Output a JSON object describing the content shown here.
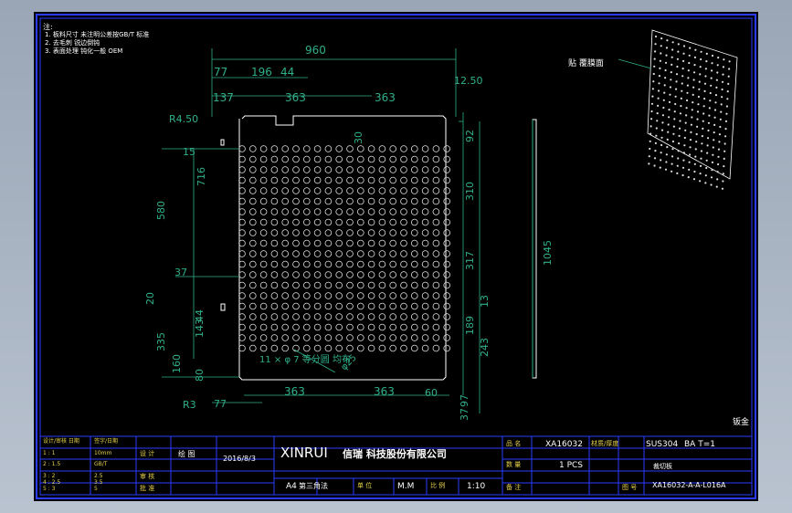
{
  "notes": {
    "heading": "注:",
    "lines": [
      "1. 板料尺寸 未注明公差按GB/T 标准",
      "2. 去毛刺 锐边倒钝",
      "3. 表面处理 钝化一般 OEM"
    ]
  },
  "dimensions": {
    "top": [
      "960",
      "77",
      "196",
      "44",
      "137",
      "363",
      "363",
      "12.50"
    ],
    "left": [
      "R4.50",
      "15",
      "716",
      "580",
      "37",
      "20",
      "335",
      "143",
      "44",
      "160",
      "80",
      "R3"
    ],
    "right": [
      "92",
      "310",
      "317",
      "13",
      "189",
      "243",
      "60",
      "97",
      "37"
    ],
    "bottom": [
      "77",
      "363",
      "363"
    ],
    "misc": [
      "30",
      "φ25",
      "11 × φ  7 等分圆 均布"
    ],
    "side_view_length": "1045"
  },
  "iso_label": "贴 覆膜面",
  "corner_mark": "钣金",
  "title_block": {
    "company_latin": "XINRUI",
    "company_cn": "信瑞 科技股份有限公司",
    "left_grid": [
      [
        "设计/审核 日期",
        "签字/日期"
      ],
      [
        "1 : 1",
        "10mm"
      ],
      [
        "2 : 1.5",
        "GB/T"
      ],
      [
        "3 : 2",
        "2.5"
      ],
      [
        "4 : 2.5",
        "3.5"
      ],
      [
        "5 : 3",
        "5"
      ]
    ],
    "drawn_by": "设 计",
    "checked_by": "审 核",
    "approved_by": "批 准",
    "designer": "绘 图",
    "date": "2016/8/3",
    "sheet_size": "A4",
    "angle": "第三角法",
    "unit_label": "单 位",
    "unit": "M.M",
    "scale_label": "比 例",
    "scale": "1:10",
    "name_label": "品 名",
    "part_no": "XA16032",
    "material_label": "材质/厚度",
    "material": "SUS304",
    "thickness": "BA T=1",
    "qty_label": "数 量",
    "qty": "1   PCS",
    "drawing_no_label": "图 号",
    "drawing_no": "XA16032-A-A-L016A",
    "remark_label": "备 注",
    "remark": "裁切板"
  }
}
